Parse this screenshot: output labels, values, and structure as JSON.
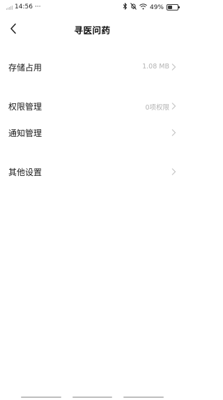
{
  "status_bar": {
    "time": "14:56",
    "more": "···",
    "battery_text": "49%",
    "battery_level": 0.49
  },
  "header": {
    "title": "寻医问药"
  },
  "settings": [
    {
      "label": "存储占用",
      "value": "1.08 MB"
    },
    {
      "label": "权限管理",
      "value": "0项权限"
    },
    {
      "label": "通知管理",
      "value": ""
    },
    {
      "label": "其他设置",
      "value": ""
    }
  ],
  "icons": {
    "back": "chevron-left-icon",
    "row_arrow": "chevron-right-icon",
    "bluetooth": "bluetooth-icon",
    "mute": "bell-off-icon",
    "wifi": "wifi-icon",
    "battery": "battery-icon"
  },
  "colors": {
    "background": "#ffffff",
    "text": "#1a1a1a",
    "secondary_text": "#b3b3b3"
  }
}
